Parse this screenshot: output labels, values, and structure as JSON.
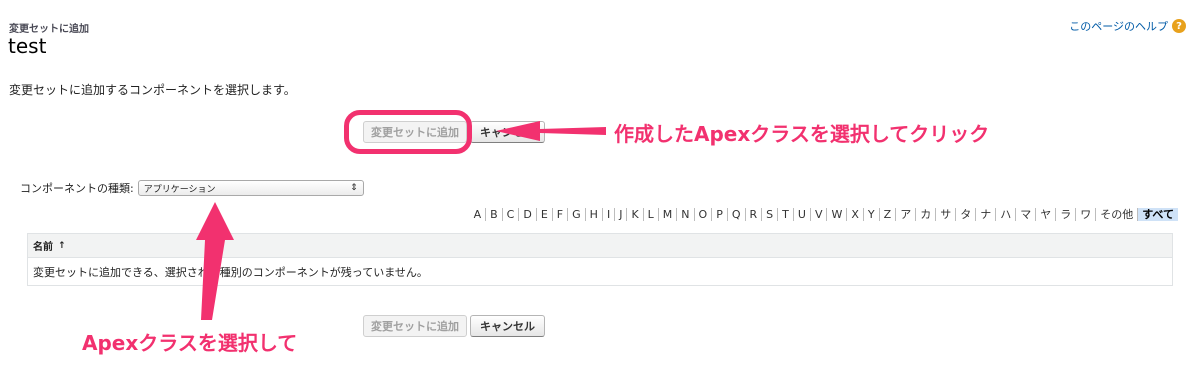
{
  "header": {
    "breadcrumb": "変更セットに追加",
    "title": "test",
    "help_label": "このページのヘルプ",
    "help_icon_glyph": "?"
  },
  "description": "変更セットに追加するコンポーネントを選択します。",
  "top_buttons": {
    "add_label": "変更セットに追加",
    "cancel_label": "キャンセル"
  },
  "component_type": {
    "label": "コンポーネントの種類:",
    "selected": "アプリケーション",
    "arrow_glyph": "⇕"
  },
  "alpha_filter": {
    "items": [
      "A",
      "B",
      "C",
      "D",
      "E",
      "F",
      "G",
      "H",
      "I",
      "J",
      "K",
      "L",
      "M",
      "N",
      "O",
      "P",
      "Q",
      "R",
      "S",
      "T",
      "U",
      "V",
      "W",
      "X",
      "Y",
      "Z",
      "ア",
      "カ",
      "サ",
      "タ",
      "ナ",
      "ハ",
      "マ",
      "ヤ",
      "ラ",
      "ワ",
      "その他",
      "すべて"
    ],
    "active": "すべて"
  },
  "table": {
    "column_name": "名前",
    "sort_glyph": "↑",
    "empty_message": "変更セットに追加できる、選択された種別のコンポーネントが残っていません。"
  },
  "bottom_buttons": {
    "add_label": "変更セットに追加",
    "cancel_label": "キャンセル"
  },
  "annotations": {
    "top": "作成したApexクラスを選択してクリック",
    "bottom": "Apexクラスを選択して",
    "color": "#f2316f"
  }
}
